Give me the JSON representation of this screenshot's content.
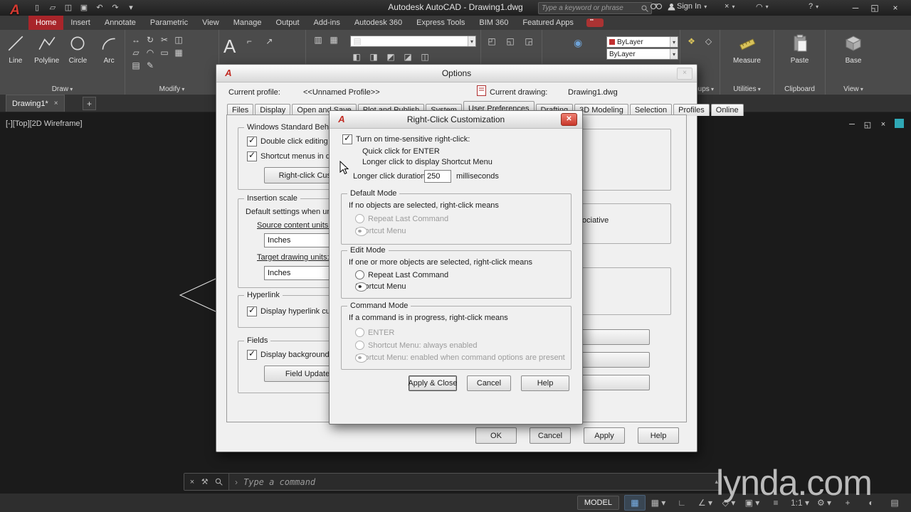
{
  "titlebar": {
    "title": "Autodesk AutoCAD - Drawing1.dwg",
    "search_placeholder": "Type a keyword or phrase",
    "signin_label": "Sign In",
    "qat_icons": [
      {
        "name": "new-file-icon",
        "glyph": "▯"
      },
      {
        "name": "open-file-icon",
        "glyph": "▱"
      },
      {
        "name": "save-icon",
        "glyph": "◫"
      },
      {
        "name": "plot-icon",
        "glyph": "▣"
      },
      {
        "name": "undo-icon",
        "glyph": "↶"
      },
      {
        "name": "redo-icon",
        "glyph": "↷"
      },
      {
        "name": "qat-more-icon",
        "glyph": "▾"
      }
    ]
  },
  "ribbon": {
    "tabs": [
      {
        "label": "Home",
        "active": true
      },
      {
        "label": "Insert"
      },
      {
        "label": "Annotate"
      },
      {
        "label": "Parametric"
      },
      {
        "label": "View"
      },
      {
        "label": "Manage"
      },
      {
        "label": "Output"
      },
      {
        "label": "Add-ins"
      },
      {
        "label": "Autodesk 360"
      },
      {
        "label": "Express Tools"
      },
      {
        "label": "BIM 360"
      },
      {
        "label": "Featured Apps"
      }
    ],
    "draw_tools": {
      "line": "Line",
      "polyline": "Polyline",
      "circle": "Circle",
      "arc": "Arc"
    },
    "panel_draw": "Draw",
    "panel_modify": "Modify",
    "panel_groups": "Groups",
    "panel_utilities": "Utilities",
    "panel_clipboard": "Clipboard",
    "panel_view": "View",
    "bylayer_top": "ByLayer",
    "bylayer_bottom": "ByLayer",
    "measure_label": "Measure",
    "paste_label": "Paste",
    "base_label": "Base"
  },
  "drawing_area": {
    "file_tab": "Drawing1*",
    "viewport_label": "[-][Top][2D Wireframe]"
  },
  "options_dialog": {
    "title": "Options",
    "profile_label": "Current profile:",
    "profile_value": "<<Unnamed Profile>>",
    "drawing_label": "Current drawing:",
    "drawing_value": "Drawing1.dwg",
    "tabs": [
      {
        "label": "Files"
      },
      {
        "label": "Display"
      },
      {
        "label": "Open and Save"
      },
      {
        "label": "Plot and Publish"
      },
      {
        "label": "System"
      },
      {
        "label": "User Preferences",
        "active": true
      },
      {
        "label": "Drafting"
      },
      {
        "label": "3D Modeling"
      },
      {
        "label": "Selection"
      },
      {
        "label": "Profiles"
      },
      {
        "label": "Online"
      }
    ],
    "win_behavior": {
      "legend": "Windows Standard Behavior",
      "cb_double_click": "Double click editing",
      "cb_shortcut_menus": "Shortcut menus in drawing area",
      "btn_right_click": "Right-click Customization..."
    },
    "insertion_scale": {
      "legend": "Insertion scale",
      "desc": "Default settings when units are set to unitless",
      "source_label": "Source content units:",
      "source_value": "Inches",
      "target_label": "Target drawing units:",
      "target_value": "Inches"
    },
    "hyperlink": {
      "legend": "Hyperlink",
      "cb": "Display hyperlink cursor, tooltip, and shortcut menu"
    },
    "fields": {
      "legend": "Fields",
      "cb": "Display background of fields",
      "btn": "Field Update Settings..."
    },
    "assoc_label": "Make new dimensions associative",
    "buttons": {
      "ok": "OK",
      "cancel": "Cancel",
      "apply": "Apply",
      "help": "Help"
    }
  },
  "rcc_dialog": {
    "title": "Right-Click Customization",
    "cb_time_sensitive": "Turn on time-sensitive right-click:",
    "line_quick": "Quick click for ENTER",
    "line_longer": "Longer click to display Shortcut Menu",
    "duration_label": "Longer click duration:",
    "duration_value": "250",
    "duration_units": "milliseconds",
    "default_mode": {
      "legend": "Default Mode",
      "desc": "If no objects are selected, right-click means",
      "r1": "Repeat Last Command",
      "r2": "Shortcut Menu"
    },
    "edit_mode": {
      "legend": "Edit Mode",
      "desc": "If one or more objects are selected, right-click means",
      "r1": "Repeat Last Command",
      "r2": "Shortcut Menu"
    },
    "command_mode": {
      "legend": "Command Mode",
      "desc": "If a command is in progress, right-click means",
      "r1": "ENTER",
      "r2": "Shortcut Menu: always enabled",
      "r3": "Shortcut Menu: enabled when command options are present"
    },
    "btn_apply_close": "Apply & Close",
    "btn_cancel": "Cancel",
    "btn_help": "Help"
  },
  "command_line": {
    "placeholder": "Type a command"
  },
  "status_bar": {
    "model_label": "MODEL",
    "icons": [
      {
        "name": "grid-icon",
        "glyph": "▦",
        "active": true
      },
      {
        "name": "snap-icon",
        "glyph": "▦ ▾"
      },
      {
        "name": "ortho-icon",
        "glyph": "∟"
      },
      {
        "name": "polar-tracking-icon",
        "glyph": "∠ ▾"
      },
      {
        "name": "isodraft-icon",
        "glyph": "◇ ▾"
      },
      {
        "name": "osnap-icon",
        "glyph": "▣ ▾"
      },
      {
        "name": "lineweight-icon",
        "glyph": "≡"
      },
      {
        "name": "annotation-scale",
        "glyph": "1:1 ▾"
      },
      {
        "name": "workspace-icon",
        "glyph": "⚙ ▾"
      },
      {
        "name": "annotation-monitor-icon",
        "glyph": "+"
      },
      {
        "name": "isolate-icon",
        "glyph": "◐"
      },
      {
        "name": "customization-icon",
        "glyph": "▤"
      }
    ]
  },
  "watermark": "lynda.com"
}
